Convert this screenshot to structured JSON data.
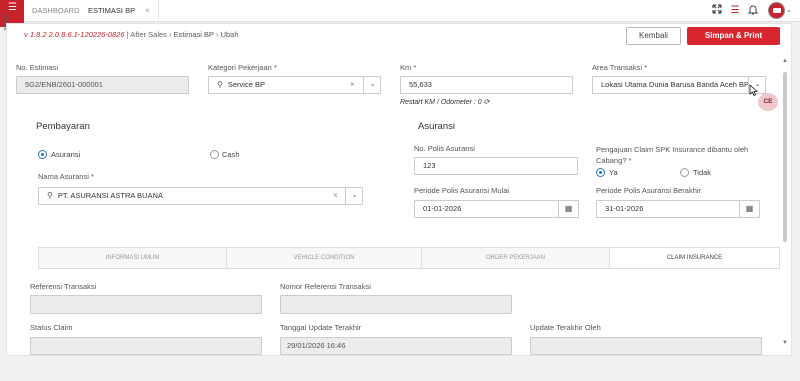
{
  "topbar": {
    "menu_label": "MENU",
    "tabs": [
      {
        "label": "DASHBOARD"
      },
      {
        "label": "ESTIMASI BP",
        "close": "×"
      }
    ]
  },
  "breadcrumb": {
    "version": "v 1.8.2 2.0.8.6.1-120226-0826",
    "sep": "|",
    "crumb1": "After Sales",
    "crumb2": "Estimasi BP",
    "crumb3": "Ubah",
    "chevron": "›"
  },
  "actions": {
    "kembali": "Kembali",
    "simpan": "Simpan & Print"
  },
  "form": {
    "no_estimasi": {
      "label": "No. Estimasi",
      "value": "5G2/ENB/2601-000001"
    },
    "kategori": {
      "label": "Kategori Pekerjaan *",
      "value": "Service BP"
    },
    "km": {
      "label": "Km *",
      "value": "55,633",
      "hint": "Restart KM / Odometer : 0"
    },
    "area": {
      "label": "Area Transaksi *",
      "value": "Lokasi Utama Dunia Barusa Banda Aceh BP"
    }
  },
  "pembayaran": {
    "title": "Pembayaran",
    "opt_asuransi": "Asuransi",
    "opt_cash": "Cash",
    "nama_asuransi_label": "Nama Asuransi *",
    "nama_asuransi_value": "PT. ASURANSI ASTRA BUANA"
  },
  "asuransi": {
    "title": "Asuransi",
    "no_polis_label": "No. Polis Asuransi",
    "no_polis_value": "123",
    "claim_label": "Pengajuan Claim SPK Insurance dibantu oleh Cabang? *",
    "opt_ya": "Ya",
    "opt_tidak": "Tidak",
    "mulai_label": "Periode Polis Asuransi Mulai",
    "mulai_value": "01-01-2026",
    "berakhir_label": "Periode Polis Asuransi Berakhir",
    "berakhir_value": "31-01-2026"
  },
  "subtabs": [
    "INFORMASI UMUM",
    "VEHICLE CONDITION",
    "ORDER PEKERJAAN",
    "CLAIM INSURANCE"
  ],
  "claim": {
    "ref_transaksi_label": "Referensi Transaksi",
    "nomor_ref_label": "Nomor Referensi Transaksi",
    "status_label": "Status Claim",
    "tanggal_update_label": "Tanggal Update Terakhir",
    "tanggal_update_value": "29/01/2026 16:46",
    "update_oleh_label": "Update Terakhir Oleh"
  },
  "badge": {
    "ce": "CE"
  },
  "icons": {
    "search": "search-icon",
    "calendar": "calendar-icon",
    "refresh": "refresh-icon",
    "expand": "expand-icon",
    "list": "list-icon",
    "bell": "bell-icon"
  },
  "colors": {
    "brand": "#d9262e",
    "radio": "#2c6fb5"
  }
}
